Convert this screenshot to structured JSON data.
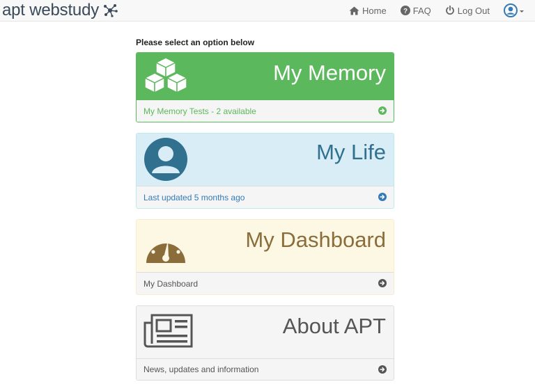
{
  "navbar": {
    "brand": "apt webstudy",
    "links": {
      "home": "Home",
      "faq": "FAQ",
      "logout": "Log Out"
    }
  },
  "main": {
    "prompt": "Please select an option below",
    "panels": [
      {
        "title": "My Memory",
        "footer": "My Memory Tests - 2 available",
        "icon": "cubes-icon"
      },
      {
        "title": "My Life",
        "footer": "Last updated 5 months ago",
        "icon": "user-icon"
      },
      {
        "title": "My Dashboard",
        "footer": "My Dashboard",
        "icon": "dashboard-icon"
      },
      {
        "title": "About APT",
        "footer": "News, updates and information",
        "icon": "newspaper-icon"
      }
    ]
  },
  "colors": {
    "memory": "#5cb85c",
    "life": "#31708f",
    "dashboard": "#8a6d3b",
    "about": "#555555"
  }
}
